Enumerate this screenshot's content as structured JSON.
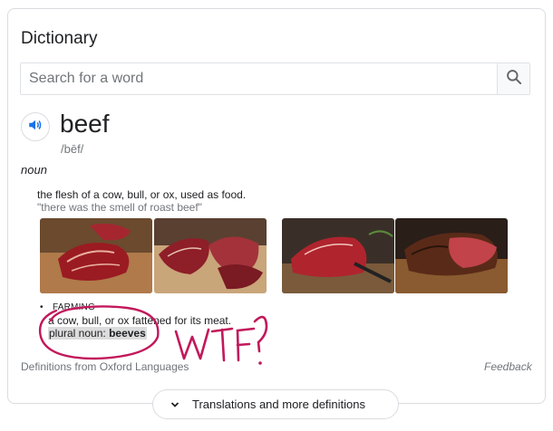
{
  "dictionary": {
    "title": "Dictionary",
    "search": {
      "placeholder": "Search for a word",
      "value": ""
    },
    "entry": {
      "word": "beef",
      "phonetic": "/bēf/",
      "part_of_speech": "noun",
      "sense1": {
        "definition": "the flesh of a cow, bull, or ox, used as food.",
        "example": "\"there was the smell of roast beef\""
      },
      "sense2": {
        "label": "FARMING",
        "definition": "a cow, bull, or ox fattened for its meat.",
        "plural_prefix": "plural noun:",
        "plural_word": "beeves"
      }
    },
    "source": "Definitions from Oxford Languages",
    "feedback": "Feedback",
    "more_button": "Translations and more definitions"
  },
  "annotation": {
    "text": "WTF?",
    "color": "#c2185b"
  },
  "colors": {
    "accent": "#1a73e8",
    "muted": "#70757a"
  },
  "icons": [
    "search-icon",
    "speaker-icon",
    "chevron-down-icon"
  ]
}
